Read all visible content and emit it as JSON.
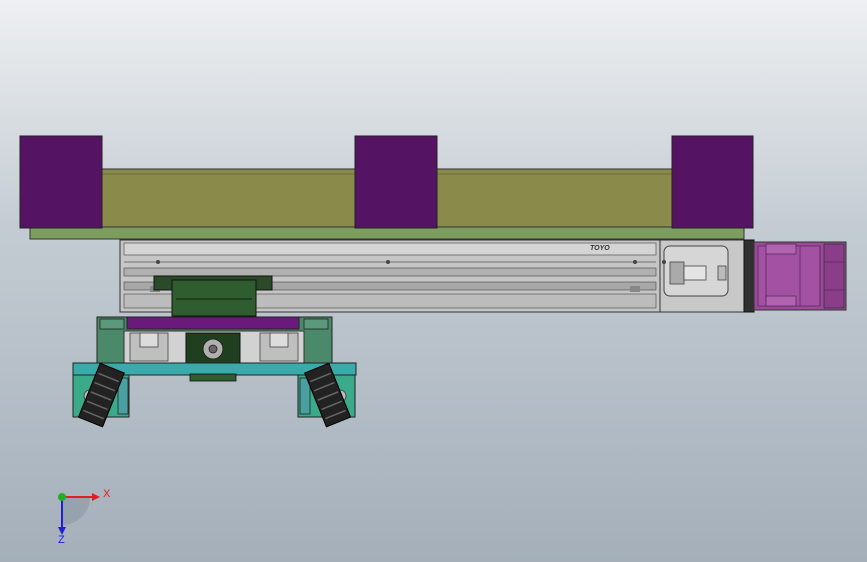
{
  "rail_logo": "TOYO",
  "triad": {
    "x_label": "X",
    "z_label": "Z",
    "x_color": "#e02020",
    "y_color": "#20b020",
    "z_color": "#2020d0"
  },
  "colors": {
    "purple_block": "#551363",
    "olive_plate": "#8a8a4a",
    "green_base": "#7d9d5f",
    "rail_gray": "#c0c0c0",
    "motor_purple": "#9a4a9a",
    "dark_green": "#2a5a2a",
    "teal": "#3aaaaa",
    "mid_green": "#4a8a6a"
  }
}
